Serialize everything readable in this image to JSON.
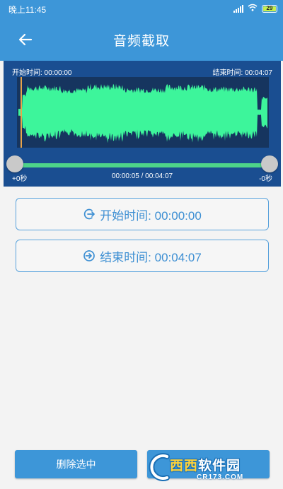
{
  "status_bar": {
    "time": "晚上11:45",
    "battery": "29",
    "icons": [
      "signal-icon",
      "wifi-icon",
      "battery-icon"
    ]
  },
  "app_bar": {
    "back_icon": "arrow-left-icon",
    "title": "音频截取"
  },
  "waveform": {
    "start_label": "开始时间: 00:00:00",
    "end_label": "结束时间: 00:04:07",
    "offset_left": "+0秒",
    "position": "00:00:05 / 00:04:07",
    "offset_right": "-0秒",
    "colors": {
      "panel": "#1a4e91",
      "wave": "#3df59b",
      "track": "#4dd489",
      "playhead": "#e8a34a"
    }
  },
  "buttons": {
    "start_time": "开始时间: 00:00:00",
    "end_time": "结束时间: 00:04:07",
    "delete_selected": "删除选中",
    "start_icon": "arrow-circle-right-out-icon",
    "end_icon": "arrow-circle-right-in-icon"
  },
  "watermark": {
    "brand_a": "西西",
    "brand_b": "软件园",
    "url": "CR173.COM"
  },
  "theme": {
    "primary": "#3d96d8",
    "background": "#f3f3f3",
    "accent_text": "#3d8fd3"
  }
}
